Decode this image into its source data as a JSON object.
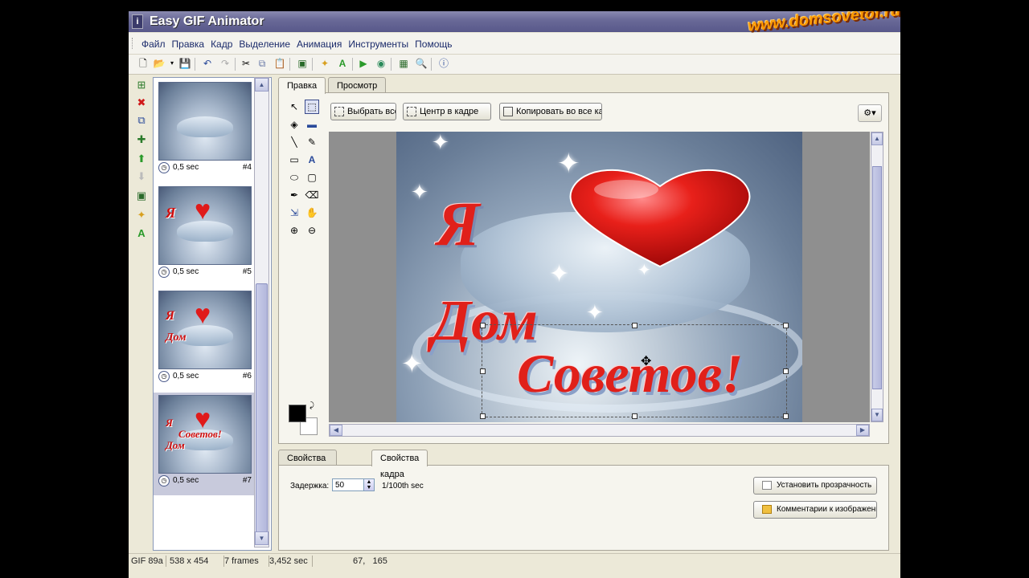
{
  "window": {
    "title": "Easy GIF Animator",
    "watermark": "www.domsovetof.ru"
  },
  "menu": [
    "Файл",
    "Правка",
    "Кадр",
    "Выделение",
    "Анимация",
    "Инструменты",
    "Помощь"
  ],
  "frames": [
    {
      "time": "0,5 sec",
      "num": "#4",
      "lines": []
    },
    {
      "time": "0,5 sec",
      "num": "#5",
      "lines": [
        "Я"
      ]
    },
    {
      "time": "0,5 sec",
      "num": "#6",
      "lines": [
        "Я",
        "Дом"
      ]
    },
    {
      "time": "0,5 sec",
      "num": "#7",
      "lines": [
        "Я",
        "Советов!",
        "Дом"
      ]
    }
  ],
  "tabs": {
    "edit": "Правка",
    "preview": "Просмотр"
  },
  "edit_buttons": {
    "select_all": "Выбрать все",
    "center": "Центр в кадре",
    "copy_all": "Копировать во все кадр"
  },
  "canvas_text": {
    "ya": "Я",
    "dom": "Дом",
    "sov": "Советов!"
  },
  "prop_tabs": {
    "animation": "Свойства анимации",
    "frame": "Свойства кадра"
  },
  "frame_props": {
    "delay_label": "Задержка:",
    "delay_value": "50",
    "delay_unit": "1/100th sec",
    "set_transparency": "Установить прозрачность",
    "comments": "Комментарии к изображению"
  },
  "status": {
    "format": "GIF 89a",
    "size": "538 x 454",
    "frames": "7 frames",
    "duration": "3,452 sec",
    "coords": "67,   165"
  },
  "colors": {
    "accent": "#e0201a",
    "title_bar": "#6a6a98",
    "selected_frame": "#c8cadc"
  }
}
